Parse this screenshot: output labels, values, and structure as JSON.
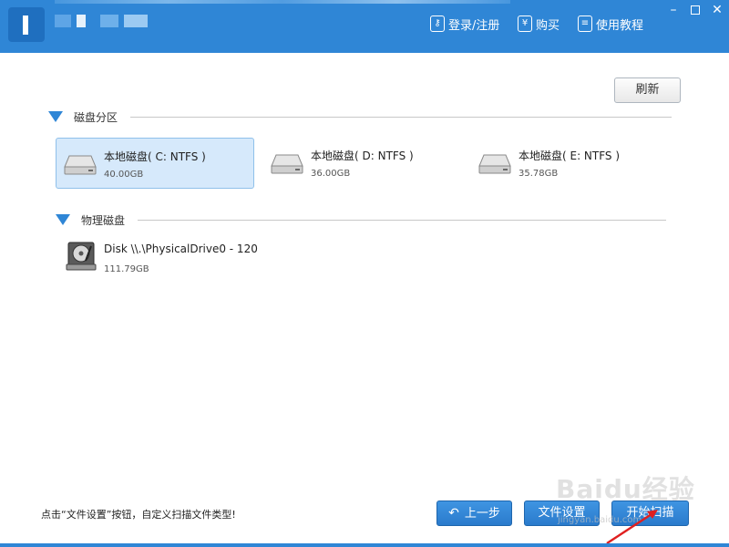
{
  "titlebar": {
    "login_label": "登录/注册",
    "buy_label": "购买",
    "help_label": "使用教程",
    "minimize": "–",
    "close": "✕"
  },
  "toolbar": {
    "refresh_label": "刷新"
  },
  "partitions": {
    "title": "磁盘分区",
    "items": [
      {
        "name": "本地磁盘( C: NTFS )",
        "size": "40.00GB",
        "selected": true
      },
      {
        "name": "本地磁盘( D: NTFS )",
        "size": "36.00GB",
        "selected": false
      },
      {
        "name": "本地磁盘( E: NTFS )",
        "size": "35.78GB",
        "selected": false
      }
    ]
  },
  "physical": {
    "title": "物理磁盘",
    "items": [
      {
        "name": "Disk \\\\.\\PhysicalDrive0 - 120",
        "size": "111.79GB"
      }
    ]
  },
  "footer": {
    "tip": "点击“文件设置”按钮，自定义扫描文件类型!",
    "prev_label": "上一步",
    "settings_label": "文件设置",
    "start_label": "开始扫描"
  },
  "watermark": {
    "brand": "Baidu经验",
    "url": "jingyan.baidu.com"
  },
  "colors": {
    "accent": "#2f86d6",
    "selected_bg": "#d6e9fb"
  }
}
